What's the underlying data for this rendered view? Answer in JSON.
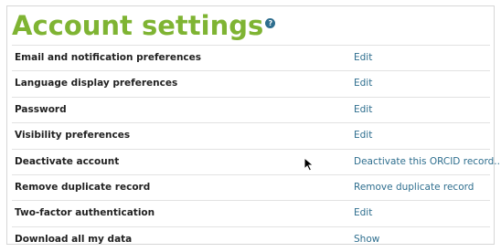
{
  "page": {
    "title": "Account settings",
    "help_icon": "question-circle-icon"
  },
  "settings": [
    {
      "label": "Email and notification preferences",
      "action": "Edit"
    },
    {
      "label": "Language display preferences",
      "action": "Edit"
    },
    {
      "label": "Password",
      "action": "Edit"
    },
    {
      "label": "Visibility preferences",
      "action": "Edit"
    },
    {
      "label": "Deactivate account",
      "action": "Deactivate this ORCID record..."
    },
    {
      "label": "Remove duplicate record",
      "action": "Remove duplicate record"
    },
    {
      "label": "Two-factor authentication",
      "action": "Edit"
    },
    {
      "label": "Download all my data",
      "action": "Show"
    }
  ],
  "colors": {
    "title": "#7fb433",
    "link": "#2e6e8e",
    "label": "#222222",
    "divider": "#e2e2e2"
  },
  "cursor": "mouse-pointer-icon"
}
